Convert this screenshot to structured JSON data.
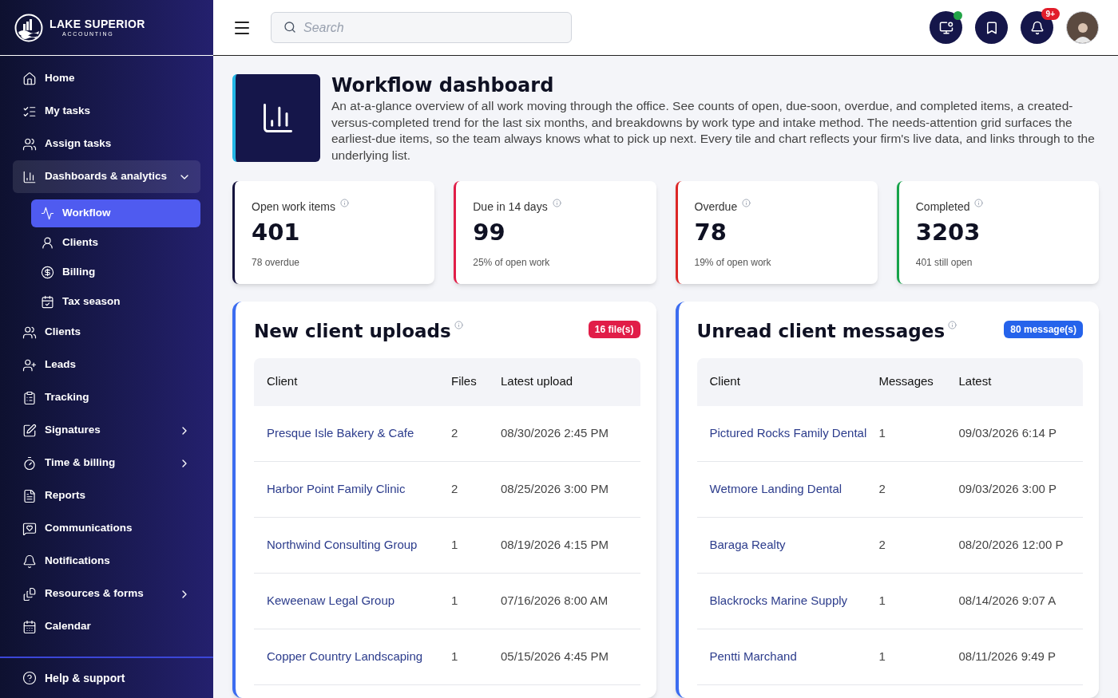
{
  "brand": {
    "name": "LAKE SUPERIOR",
    "tagline": "ACCOUNTING"
  },
  "sidebar": {
    "items": [
      {
        "label": "Home",
        "expanded": false,
        "has_children": false
      },
      {
        "label": "My tasks",
        "expanded": false,
        "has_children": false
      },
      {
        "label": "Assign tasks",
        "expanded": false,
        "has_children": false
      },
      {
        "label": "Dashboards & analytics",
        "expanded": true,
        "has_children": true,
        "children": [
          {
            "label": "Workflow",
            "selected": true
          },
          {
            "label": "Clients",
            "selected": false
          },
          {
            "label": "Billing",
            "selected": false
          },
          {
            "label": "Tax season",
            "selected": false
          }
        ]
      },
      {
        "label": "Clients",
        "expanded": false,
        "has_children": false
      },
      {
        "label": "Leads",
        "expanded": false,
        "has_children": false
      },
      {
        "label": "Tracking",
        "expanded": false,
        "has_children": false
      },
      {
        "label": "Signatures",
        "expanded": false,
        "has_children": true
      },
      {
        "label": "Time & billing",
        "expanded": false,
        "has_children": true
      },
      {
        "label": "Reports",
        "expanded": false,
        "has_children": false
      },
      {
        "label": "Communications",
        "expanded": false,
        "has_children": false
      },
      {
        "label": "Notifications",
        "expanded": false,
        "has_children": false
      },
      {
        "label": "Resources & forms",
        "expanded": false,
        "has_children": true
      },
      {
        "label": "Calendar",
        "expanded": false,
        "has_children": false
      }
    ],
    "footer": {
      "label": "Help & support"
    }
  },
  "header": {
    "search": {
      "placeholder": "Search"
    },
    "notification_badge": "9+",
    "status_online": true
  },
  "page": {
    "title": "Workflow dashboard",
    "description": "An at-a-glance overview of all work moving through the office. See counts of open, due-soon, overdue, and completed items, a created-versus-completed trend for the last six months, and breakdowns by work type and intake method. The needs-attention grid surfaces the earliest-due items, so the team always knows what to pick up next. Every tile and chart reflects your firm's live data, and links through to the underlying list."
  },
  "stats": [
    {
      "label": "Open work items",
      "value": "401",
      "note": "78 overdue",
      "color": "#15133d"
    },
    {
      "label": "Due in 14 days",
      "value": "99",
      "note": "25% of open work",
      "color": "#e11d48"
    },
    {
      "label": "Overdue",
      "value": "78",
      "note": "19% of open work",
      "color": "#dc2626"
    },
    {
      "label": "Completed",
      "value": "3203",
      "note": "401 still open",
      "color": "#16a34a"
    }
  ],
  "panels": [
    {
      "title": "New client uploads",
      "badge": "16 file(s)",
      "color": "#e11d48",
      "columns": [
        "Client",
        "Files",
        "Latest upload"
      ],
      "rows": [
        [
          "Presque Isle Bakery & Cafe",
          "2",
          "08/30/2026 2:45 PM"
        ],
        [
          "Harbor Point Family Clinic",
          "2",
          "08/25/2026 3:00 PM"
        ],
        [
          "Northwind Consulting Group",
          "1",
          "08/19/2026 4:15 PM"
        ],
        [
          "Keweenaw Legal Group",
          "1",
          "07/16/2026 8:00 AM"
        ],
        [
          "Copper Country Landscaping",
          "1",
          "05/15/2026 4:45 PM"
        ]
      ]
    },
    {
      "title": "Unread client messages",
      "badge": "80 message(s)",
      "color": "#2563eb",
      "columns": [
        "Client",
        "Messages",
        "Latest"
      ],
      "rows": [
        [
          "Pictured Rocks Family Dental",
          "1",
          "09/03/2026 6:14 P"
        ],
        [
          "Wetmore Landing Dental",
          "2",
          "09/03/2026 3:00 P"
        ],
        [
          "Baraga Realty",
          "2",
          "08/20/2026 12:00 P"
        ],
        [
          "Blackrocks Marine Supply",
          "1",
          "08/14/2026 9:07 A"
        ],
        [
          "Pentti Marchand",
          "1",
          "08/11/2026 9:49 P"
        ]
      ]
    }
  ]
}
